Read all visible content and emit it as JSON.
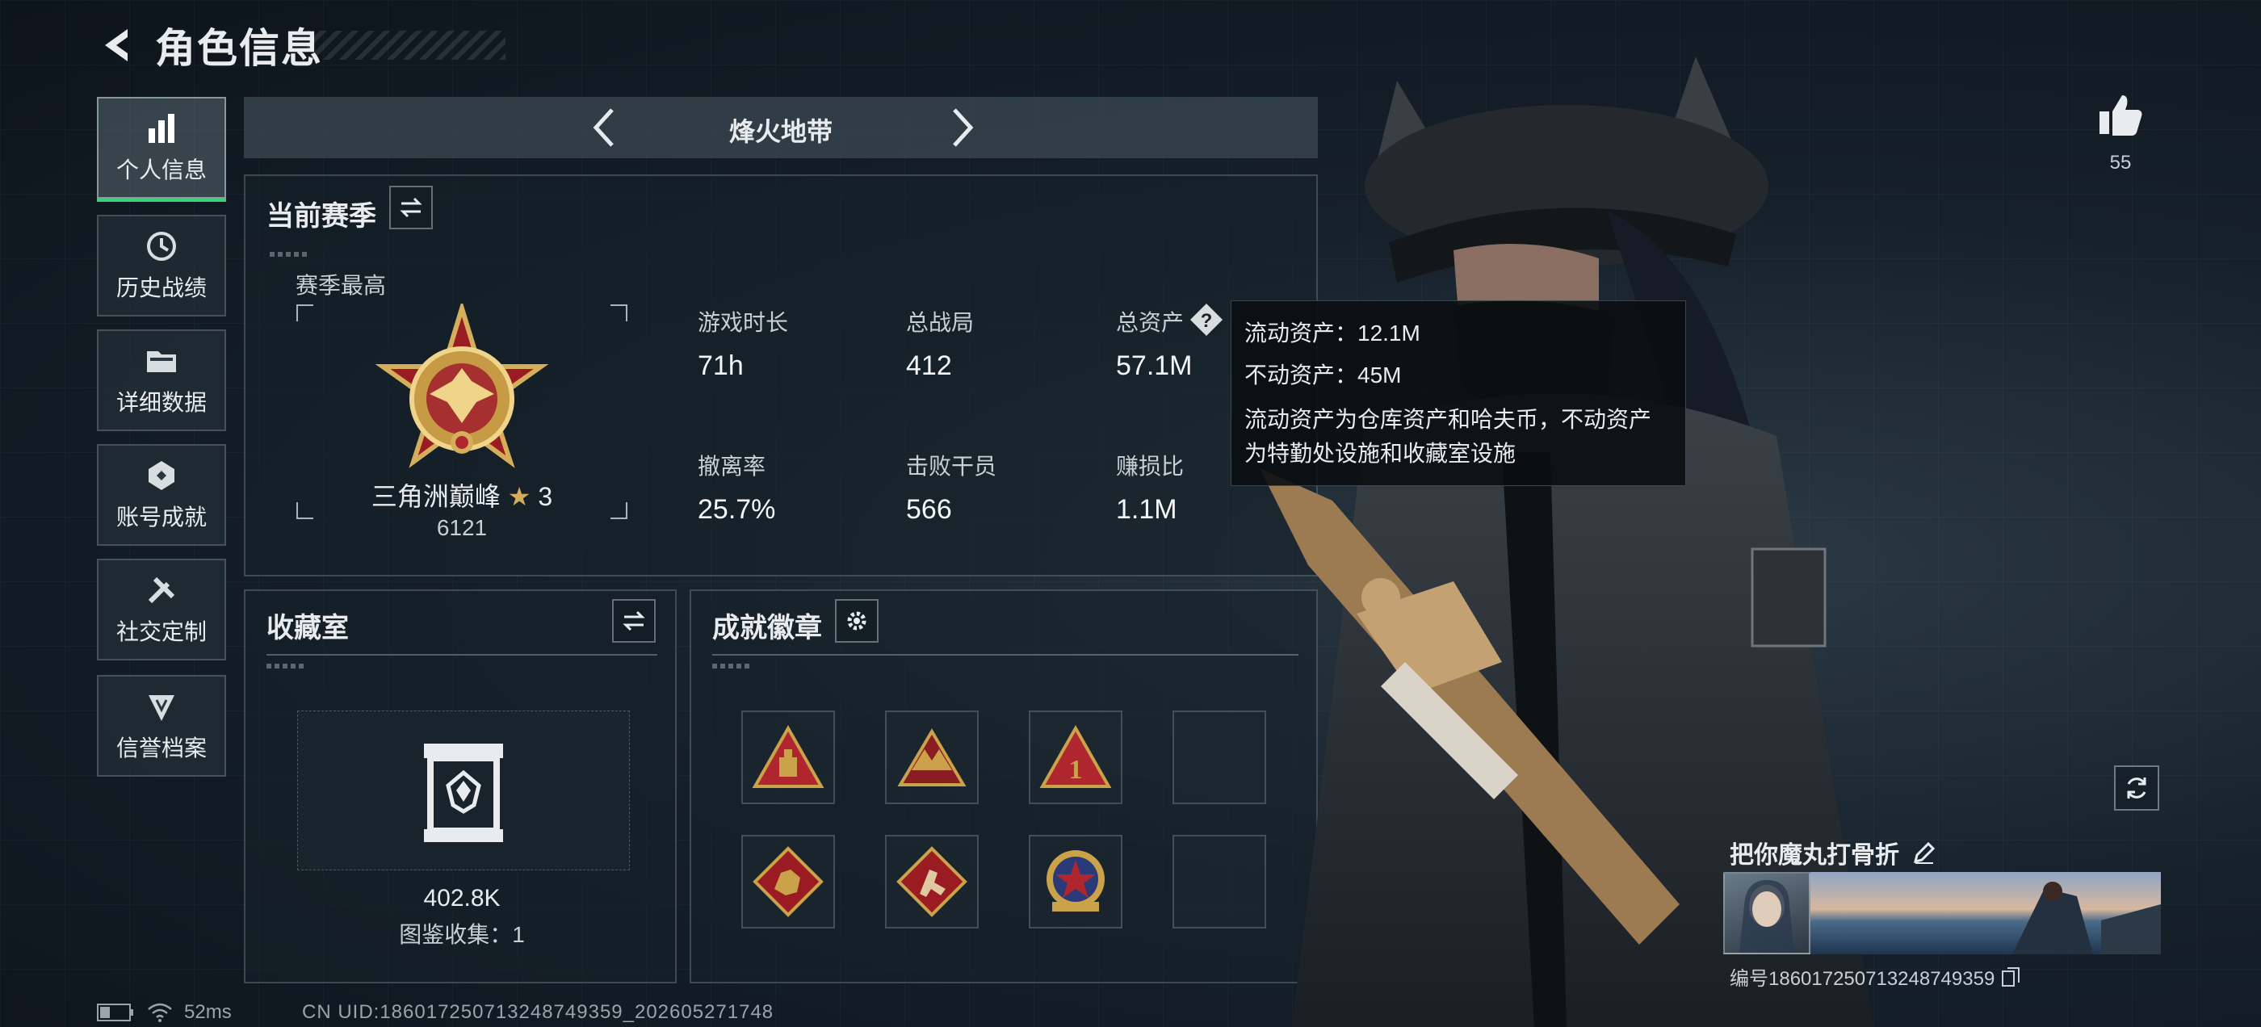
{
  "header": {
    "title": "角色信息"
  },
  "sidebar": {
    "items": [
      {
        "label": "个人信息",
        "icon": "bar-chart-icon",
        "active": true
      },
      {
        "label": "历史战绩",
        "icon": "history-icon"
      },
      {
        "label": "详细数据",
        "icon": "folder-icon"
      },
      {
        "label": "账号成就",
        "icon": "achievement-icon"
      },
      {
        "label": "社交定制",
        "icon": "tools-icon"
      },
      {
        "label": "信誉档案",
        "icon": "shield-icon"
      }
    ]
  },
  "mode": {
    "title": "烽火地带"
  },
  "season": {
    "title": "当前赛季",
    "best_label": "赛季最高",
    "rank_name": "三角洲巅峰",
    "rank_stars": "3",
    "rank_score": "6121",
    "stats": [
      {
        "label": "游戏时长",
        "value": "71h"
      },
      {
        "label": "总战局",
        "value": "412"
      },
      {
        "label": "总资产",
        "value": "57.1M"
      },
      {
        "label": "撤离率",
        "value": "25.7%"
      },
      {
        "label": "击败干员",
        "value": "566"
      },
      {
        "label": "赚损比",
        "value": "1.1M"
      }
    ]
  },
  "tooltip": {
    "line1": "流动资产：12.1M",
    "line2": "不动资产：45M",
    "desc1": "流动资产为仓库资产和哈夫币，不动资产",
    "desc2": "为特勤处设施和收藏室设施"
  },
  "collection": {
    "title": "收藏室",
    "value": "402.8K",
    "catalog": "图鉴收集：1"
  },
  "badges": {
    "title": "成就徽章",
    "items": [
      "triangle-badge-1",
      "triangle-badge-2",
      "triangle-badge-3",
      "empty",
      "diamond-badge-1",
      "diamond-badge-2",
      "round-badge-1",
      "empty"
    ]
  },
  "profile": {
    "likes": "55",
    "nickname": "把你魔丸打骨折",
    "id_label": "编号1860172507132487493​59"
  },
  "status": {
    "ping": "52ms",
    "uid": "CN UID:1860172507132487493​59_202605271748"
  },
  "colors": {
    "accent": "#3fcf7a",
    "gold": "#c9a24a",
    "red": "#b0262e"
  }
}
